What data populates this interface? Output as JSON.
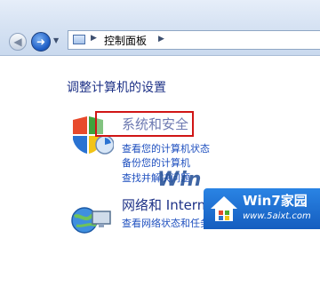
{
  "address_bar": {
    "breadcrumb": "控制面板"
  },
  "main": {
    "title": "调整计算机的设置",
    "categories": [
      {
        "title": "系统和安全",
        "links": [
          "查看您的计算机状态",
          "备份您的计算机",
          "查找并解决问题"
        ],
        "icon": "shield-icon"
      },
      {
        "title": "网络和 Internet",
        "links": [
          "查看网络状态和任务"
        ],
        "icon": "network-globe-icon"
      }
    ]
  },
  "watermark": {
    "text": "Win",
    "site_name": "Win7家园",
    "url": "www.5aixt.com"
  },
  "colors": {
    "highlight": "#d01515",
    "link": "#1e4fbf",
    "title": "#1e3287",
    "badge": "#1f6fd6"
  }
}
